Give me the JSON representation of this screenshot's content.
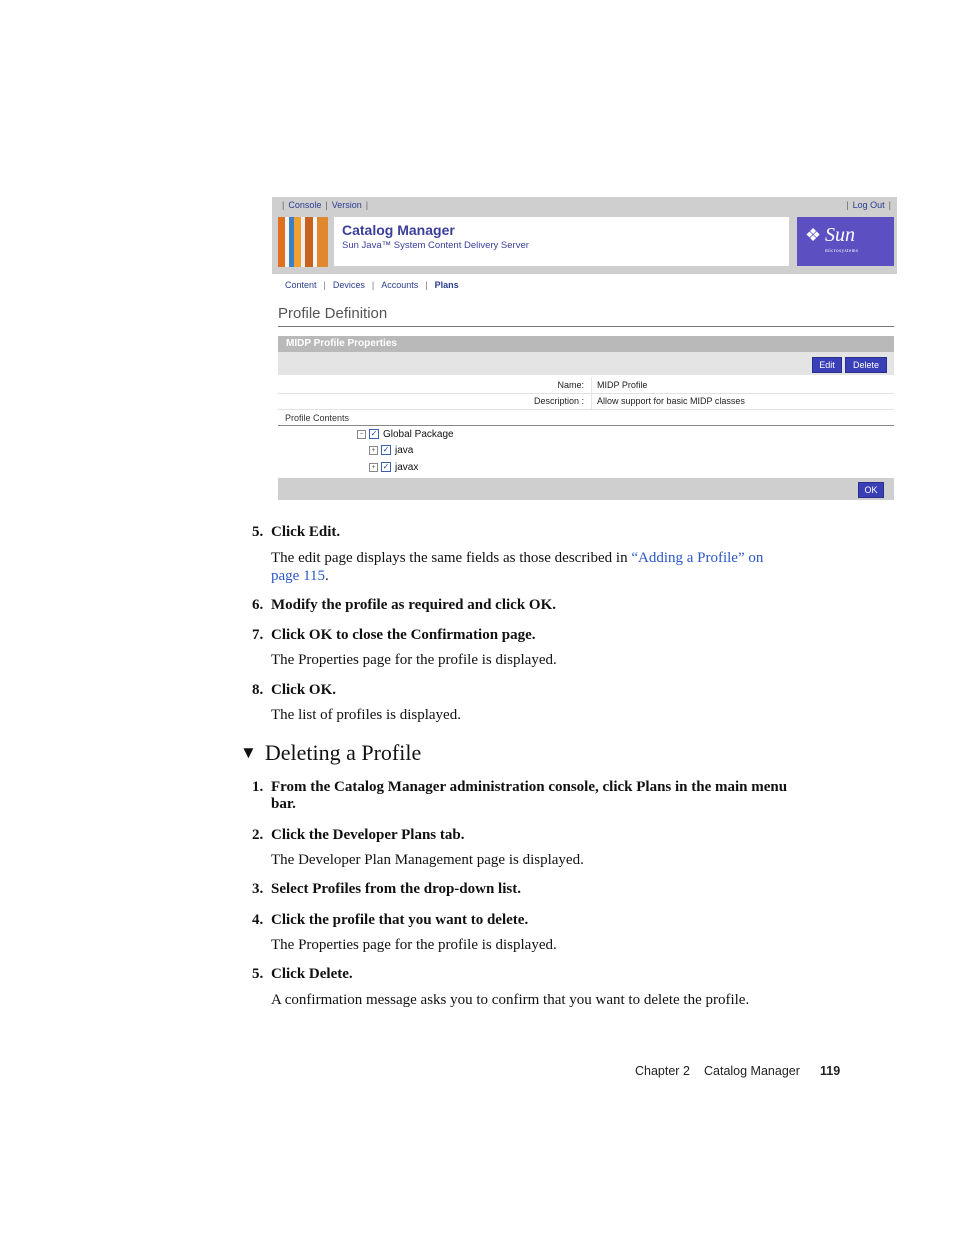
{
  "screenshot": {
    "toplinks": [
      "Console",
      "Version"
    ],
    "logout": "Log Out",
    "app_title": "Catalog Manager",
    "app_subtitle": "Sun Java™ System Content Delivery Server",
    "logo_text": "Sun",
    "logo_subtext": "microsystems",
    "nav": [
      "Content",
      "Devices",
      "Accounts",
      "Plans"
    ],
    "page_heading": "Profile Definition",
    "section_title": "MIDP Profile Properties",
    "edit_label": "Edit",
    "delete_label": "Delete",
    "fields": [
      {
        "label": "Name:",
        "value": "MIDP Profile"
      },
      {
        "label": "Description :",
        "value": "Allow support for basic MIDP classes"
      }
    ],
    "profile_contents_label": "Profile Contents",
    "tree": [
      "Global Package",
      "java",
      "javax"
    ],
    "ok_label": "OK"
  },
  "doc": {
    "s5_num": "5.",
    "s5": "Click Edit.",
    "s5_p1": "The edit page displays the same fields as those described in ",
    "s5_link1": "“Adding a Profile” on",
    "s5_link2": "page 115",
    "s5_end": ".",
    "s6_num": "6.",
    "s6": "Modify the profile as required and click OK.",
    "s7_num": "7.",
    "s7": "Click OK to close the Confirmation page.",
    "s7_p": "The Properties page for the profile is displayed.",
    "s8_num": "8.",
    "s8": "Click OK.",
    "s8_p": "The list of profiles is displayed.",
    "heading": "Deleting a Profile",
    "d1_num": "1.",
    "d1a": "From the Catalog Manager administration console, click Plans in the main menu",
    "d1b": "bar.",
    "d2_num": "2.",
    "d2": "Click the Developer Plans tab.",
    "d2_p": "The Developer Plan Management page is displayed.",
    "d3_num": "3.",
    "d3": "Select Profiles from the drop-down list.",
    "d4_num": "4.",
    "d4": "Click the profile that you want to delete.",
    "d4_p": "The Properties page for the profile is displayed.",
    "d5_num": "5.",
    "d5": "Click Delete.",
    "d5_p": "A confirmation message asks you to confirm that you want to delete the profile."
  },
  "footer": {
    "chapter": "Chapter 2",
    "title": "Catalog Manager",
    "page": "119"
  }
}
